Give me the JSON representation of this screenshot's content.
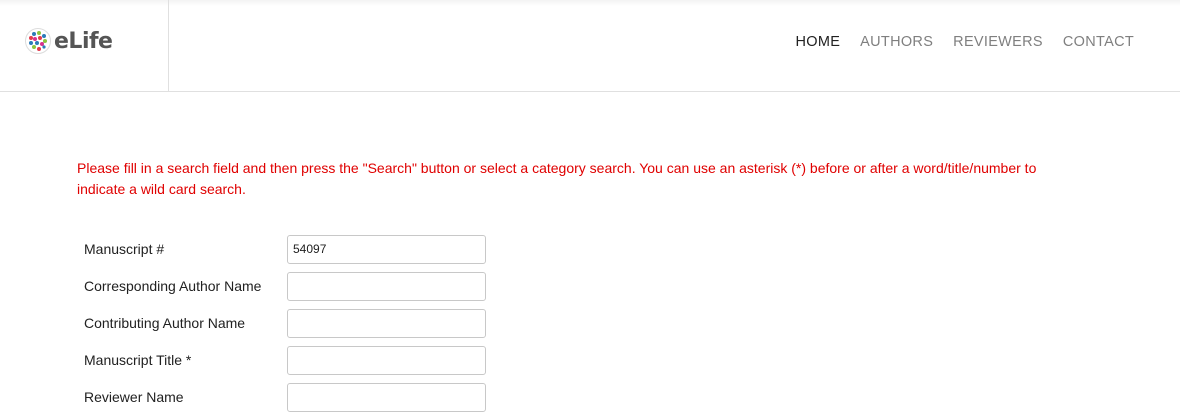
{
  "brand": {
    "name": "eLife"
  },
  "nav": {
    "items": [
      {
        "label": "HOME",
        "active": true
      },
      {
        "label": "AUTHORS",
        "active": false
      },
      {
        "label": "REVIEWERS",
        "active": false
      },
      {
        "label": "CONTACT",
        "active": false
      }
    ]
  },
  "instructions": "Please fill in a search field and then press the \"Search\" button or select a category search. You can use an asterisk (*) before or after a word/title/number to indicate a wild card search.",
  "form": {
    "fields": [
      {
        "label": "Manuscript #",
        "value": "54097"
      },
      {
        "label": "Corresponding Author Name",
        "value": ""
      },
      {
        "label": "Contributing Author Name",
        "value": ""
      },
      {
        "label": "Manuscript Title *",
        "value": ""
      },
      {
        "label": "Reviewer Name",
        "value": ""
      }
    ]
  },
  "colors": {
    "instruction_text": "#e00000",
    "nav_active": "#212121",
    "nav_inactive": "#7f7f7f"
  }
}
